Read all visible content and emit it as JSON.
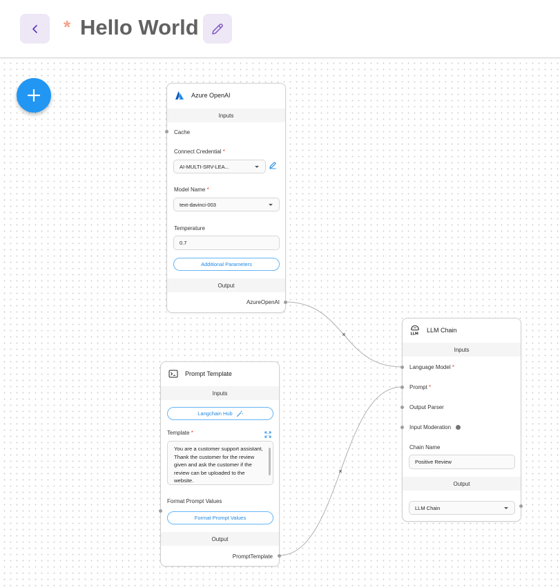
{
  "header": {
    "back_label": "Back",
    "unsaved_marker": "*",
    "title": "Hello World"
  },
  "colors": {
    "accent": "#2196f3",
    "header_button_bg": "#ede7f6",
    "unsaved_marker": "#f4a38c",
    "required": "#e53935",
    "link": "#1e88e5"
  },
  "nodes": {
    "azure": {
      "title": "Azure OpenAI",
      "icon": "azure-logo-icon",
      "inputs_label": "Inputs",
      "cache_label": "Cache",
      "credential_label": "Connect Credential",
      "credential_value": "AI-MULTI-SRV-LEA...",
      "model_label": "Model Name",
      "model_value": "text-davinci-003",
      "temperature_label": "Temperature",
      "temperature_value": "0.7",
      "additional_params": "Additional Parameters",
      "output_label": "Output",
      "output_name": "AzureOpenAI"
    },
    "prompt": {
      "title": "Prompt Template",
      "icon": "terminal-icon",
      "inputs_label": "Inputs",
      "hub_button": "Langchain Hub",
      "template_label": "Template",
      "template_value": "You are a customer support assistant, Thank the customer for the review given and ask the customer if the review can be uploaded to the website.",
      "format_label": "Format Prompt Values",
      "format_button": "Format Prompt Values",
      "output_label": "Output",
      "output_name": "PromptTemplate"
    },
    "llm": {
      "title": "LLM Chain",
      "icon": "llm-icon",
      "inputs_label": "Inputs",
      "language_model_label": "Language Model",
      "prompt_label": "Prompt",
      "output_parser_label": "Output Parser",
      "input_moderation_label": "Input Moderation",
      "chain_name_label": "Chain Name",
      "chain_name_value": "Positive Review",
      "output_label": "Output",
      "output_value": "LLM Chain"
    }
  },
  "required_marker": "*"
}
